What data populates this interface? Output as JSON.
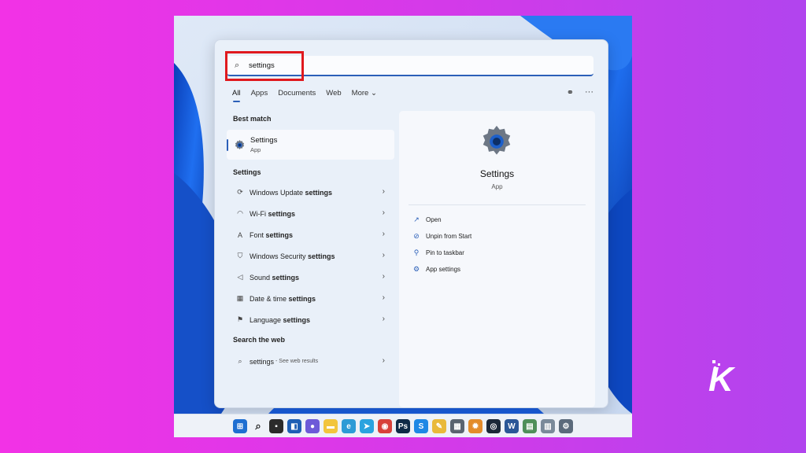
{
  "search": {
    "value": "settings"
  },
  "tabs": [
    "All",
    "Apps",
    "Documents",
    "Web",
    "More ⌄"
  ],
  "best_match": {
    "heading": "Best match",
    "title": "Settings",
    "subtitle": "App"
  },
  "settings_section": {
    "heading": "Settings",
    "items": [
      {
        "icon": "refresh-icon",
        "glyph": "⟳",
        "prefix": "Windows Update ",
        "bold": "settings"
      },
      {
        "icon": "wifi-icon",
        "glyph": "◠",
        "prefix": "Wi-Fi ",
        "bold": "settings"
      },
      {
        "icon": "font-icon",
        "glyph": "A",
        "prefix": "Font ",
        "bold": "settings"
      },
      {
        "icon": "shield-icon",
        "glyph": "⛉",
        "prefix": "Windows Security ",
        "bold": "settings"
      },
      {
        "icon": "speaker-icon",
        "glyph": "◁",
        "prefix": "Sound ",
        "bold": "settings"
      },
      {
        "icon": "calendar-icon",
        "glyph": "▦",
        "prefix": "Date & time ",
        "bold": "settings"
      },
      {
        "icon": "language-icon",
        "glyph": "⚑",
        "prefix": "Language ",
        "bold": "settings"
      }
    ]
  },
  "web_section": {
    "heading": "Search the web",
    "query": "settings",
    "hint": "- See web results"
  },
  "detail": {
    "name": "Settings",
    "type": "App",
    "actions": [
      {
        "icon": "open-icon",
        "glyph": "↗",
        "label": "Open"
      },
      {
        "icon": "unpin-icon",
        "glyph": "⊘",
        "label": "Unpin from Start"
      },
      {
        "icon": "pin-icon",
        "glyph": "⚲",
        "label": "Pin to taskbar"
      },
      {
        "icon": "gear-icon",
        "glyph": "⚙",
        "label": "App settings"
      }
    ]
  },
  "watermark": "K",
  "taskbar": [
    {
      "name": "windows-start-icon",
      "color": "#1f6fd1",
      "glyph": "⊞"
    },
    {
      "name": "search-icon",
      "color": "#eef2f8",
      "glyph": "⌕"
    },
    {
      "name": "task-view-icon",
      "color": "#2b2b2b",
      "glyph": "▪"
    },
    {
      "name": "widgets-icon",
      "color": "#1e5fb5",
      "glyph": "◧"
    },
    {
      "name": "chat-icon",
      "color": "#6d5ad8",
      "glyph": "●"
    },
    {
      "name": "file-explorer-icon",
      "color": "#f2c53d",
      "glyph": "▬"
    },
    {
      "name": "edge-icon",
      "color": "#2e9bd6",
      "glyph": "e"
    },
    {
      "name": "telegram-icon",
      "color": "#2aa3df",
      "glyph": "➤"
    },
    {
      "name": "chrome-icon",
      "color": "#d8413a",
      "glyph": "◉"
    },
    {
      "name": "photoshop-icon",
      "color": "#0f2a47",
      "glyph": "Ps"
    },
    {
      "name": "app-blue-icon",
      "color": "#1e88e5",
      "glyph": "S"
    },
    {
      "name": "sticky-icon",
      "color": "#e9b93a",
      "glyph": "✎"
    },
    {
      "name": "calculator-icon",
      "color": "#5a6470",
      "glyph": "▦"
    },
    {
      "name": "gear-yellow-icon",
      "color": "#e38c2b",
      "glyph": "✹"
    },
    {
      "name": "steam-icon",
      "color": "#1b2838",
      "glyph": "◎"
    },
    {
      "name": "word-icon",
      "color": "#2b5797",
      "glyph": "W"
    },
    {
      "name": "app-green-icon",
      "color": "#4f8f5a",
      "glyph": "▤"
    },
    {
      "name": "app-chart-icon",
      "color": "#7a8a9a",
      "glyph": "▥"
    },
    {
      "name": "settings-icon",
      "color": "#5b6a7b",
      "glyph": "⚙"
    }
  ]
}
